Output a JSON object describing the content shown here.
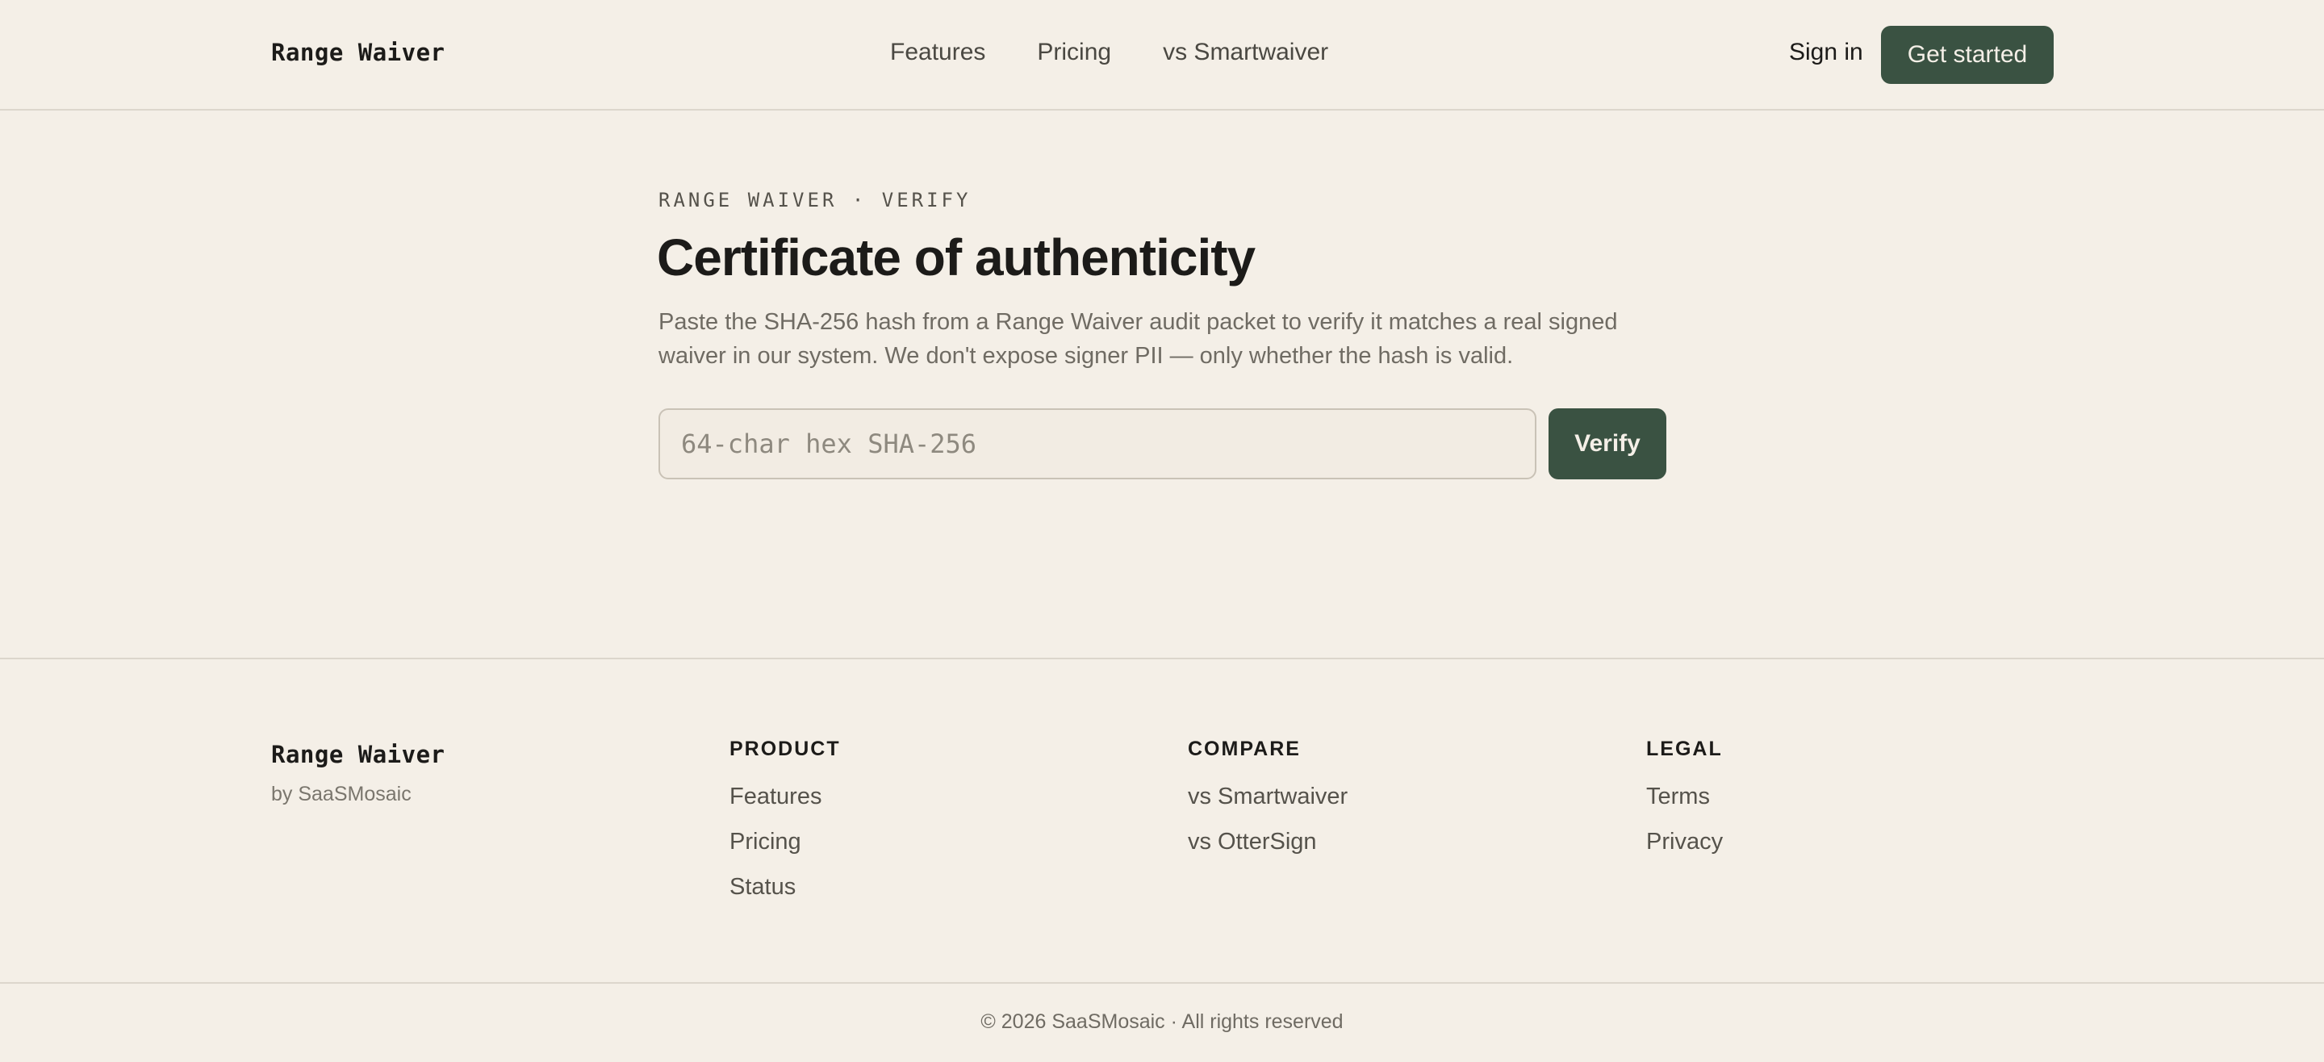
{
  "header": {
    "brand": "Range Waiver",
    "nav": [
      "Features",
      "Pricing",
      "vs Smartwaiver"
    ],
    "sign_in": "Sign in",
    "cta": "Get started"
  },
  "main": {
    "eyebrow": "RANGE WAIVER · VERIFY",
    "title": "Certificate of authenticity",
    "description": "Paste the SHA-256 hash from a Range Waiver audit packet to verify it matches a real signed waiver in our system. We don't expose signer PII — only whether the hash is valid.",
    "input_value": "",
    "input_placeholder": "64-char hex SHA-256",
    "verify_label": "Verify"
  },
  "footer": {
    "brand": "Range Waiver",
    "by": "by SaaSMosaic",
    "columns": [
      {
        "title": "PRODUCT",
        "links": [
          "Features",
          "Pricing",
          "Status"
        ]
      },
      {
        "title": "COMPARE",
        "links": [
          "vs Smartwaiver",
          "vs OtterSign"
        ]
      },
      {
        "title": "LEGAL",
        "links": [
          "Terms",
          "Privacy"
        ]
      }
    ],
    "copyright": "© 2026 SaaSMosaic · All rights reserved"
  },
  "colors": {
    "background": "#f4efe7",
    "accent": "#3a5242",
    "text": "#1c1b19",
    "muted": "#6f6b63",
    "border": "#dcd6cc"
  }
}
